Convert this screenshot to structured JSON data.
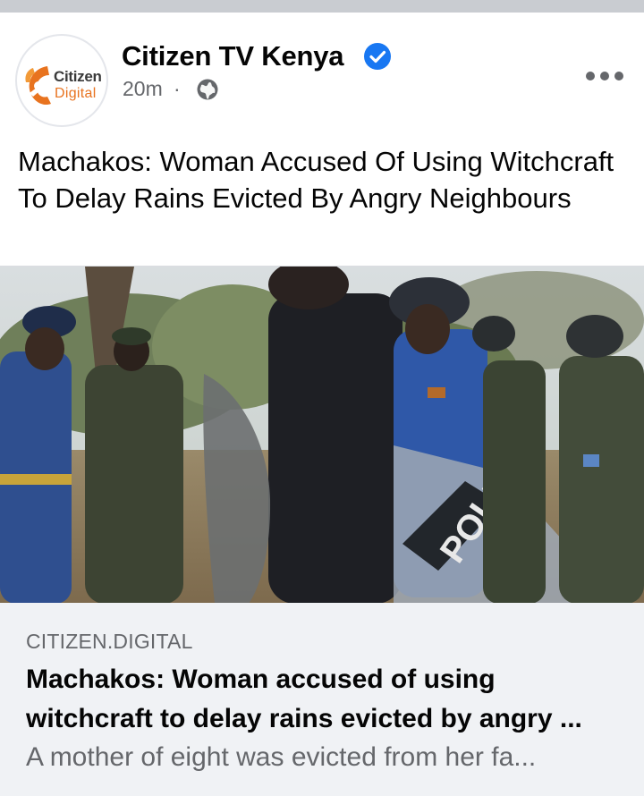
{
  "page": {
    "name": "Citizen TV Kenya",
    "verified": true,
    "time": "20m",
    "separator": "·",
    "audience_icon": "globe-icon",
    "avatar_logo": {
      "word1": "Citizen",
      "word2": "Digital"
    }
  },
  "post": {
    "text": "Machakos: Woman Accused Of Using Witchcraft To Delay Rains Evicted By Angry Neighbours",
    "image_icon": "news-photo",
    "image_shield_text": "POLICE"
  },
  "link_preview": {
    "domain": "CITIZEN.DIGITAL",
    "title_line1": "Machakos: Woman accused of using",
    "title_line2": "witchcraft to delay rains evicted by angry ...",
    "description": "A mother of eight was evicted from her fa..."
  },
  "colors": {
    "brand_orange": "#e8731f",
    "verified_blue": "#1877f2",
    "secondary_text": "#65676b",
    "link_bg": "#f0f2f5"
  }
}
